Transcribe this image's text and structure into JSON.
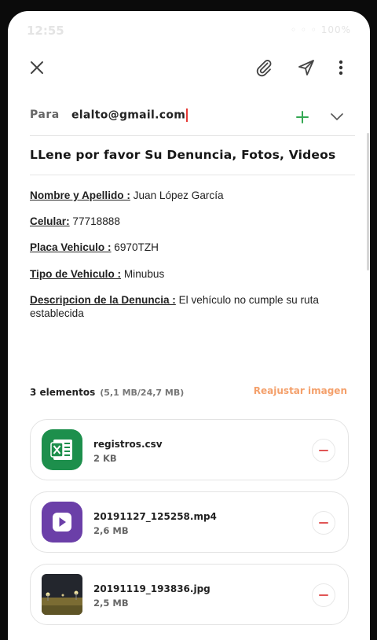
{
  "status": {
    "time": "12:55",
    "right": "◦ ◦ ◦ 100%"
  },
  "toolbar": {
    "close": "close-icon",
    "attach": "paperclip-icon",
    "send": "send-icon",
    "more": "more-vert-icon"
  },
  "recipient": {
    "label": "Para",
    "value": "elalto@gmail.com",
    "add_color": "#34a853"
  },
  "subject": "LLene por favor Su Denuncia, Fotos, Videos",
  "fields": [
    {
      "label": "Nombre y Apellido :",
      "value": " Juan López García"
    },
    {
      "label": "Celular:",
      "value": " 77718888"
    },
    {
      "label": "Placa Vehiculo :",
      "value": " 6970TZH"
    },
    {
      "label": "Tipo de Vehiculo :",
      "value": " Minubus"
    },
    {
      "label": "Descripcion de la Denuncia :",
      "value": " El vehículo no cumple su ruta establecida"
    }
  ],
  "attachments": {
    "count": "3 elementos",
    "size": "(5,1 MB/24,7 MB)",
    "resize": "Reajustar imagen",
    "items": [
      {
        "name": "registros.csv",
        "size": "2 KB",
        "icon": "excel-icon",
        "color": "#1d8f4c"
      },
      {
        "name": "20191127_125258.mp4",
        "size": "2,6 MB",
        "icon": "video-play-icon",
        "color": "#6b3fa8"
      },
      {
        "name": "20191119_193836.jpg",
        "size": "2,5 MB",
        "icon": "image-thumbnail",
        "color": "#2b2b30"
      }
    ]
  }
}
